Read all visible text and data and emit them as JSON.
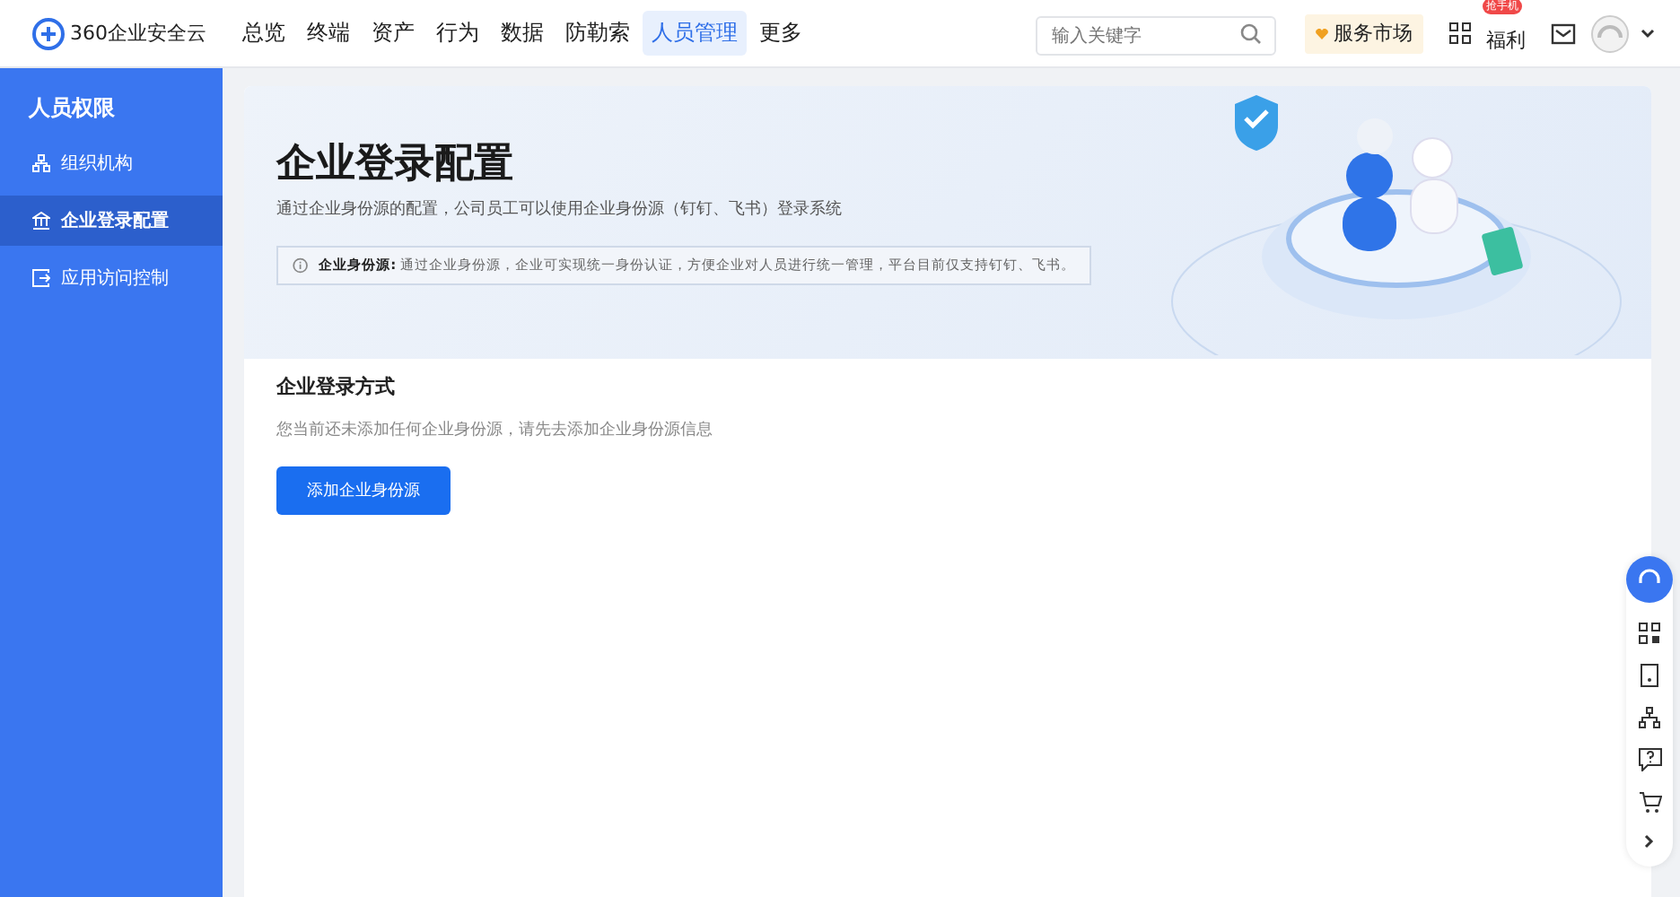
{
  "header": {
    "logo": "360企业安全云",
    "nav": [
      {
        "label": "总览",
        "selected": false
      },
      {
        "label": "终端",
        "selected": false
      },
      {
        "label": "资产",
        "selected": false
      },
      {
        "label": "行为",
        "selected": false
      },
      {
        "label": "数据",
        "selected": false
      },
      {
        "label": "防勒索",
        "selected": false
      },
      {
        "label": "人员管理",
        "selected": true
      },
      {
        "label": "更多",
        "selected": false
      }
    ],
    "search": {
      "placeholder": "输入关键字"
    },
    "market": "服务市场",
    "welfare": "福利",
    "welfare_badge": "抢手机"
  },
  "sidebar": {
    "title": "人员权限",
    "items": [
      {
        "label": "组织机构",
        "selected": false,
        "kind": "org"
      },
      {
        "label": "企业登录配置",
        "selected": true,
        "kind": "bank"
      },
      {
        "label": "应用访问控制",
        "selected": false,
        "kind": "exit"
      }
    ]
  },
  "page": {
    "title": "企业登录配置",
    "subtitle": "通过企业身份源的配置，公司员工可以使用企业身份源（钉钉、飞书）登录系统",
    "info": "**企业身份源:** 通过企业身份源，企业可实现统一身份认证，方便企业对人员进行统一管理，平台目前仅支持钉钉、飞书。",
    "section_title": "企业登录方式",
    "empty_text": "您当前还未添加任何企业身份源，请先去添加企业身份源信息",
    "add_button": "添加企业身份源"
  }
}
